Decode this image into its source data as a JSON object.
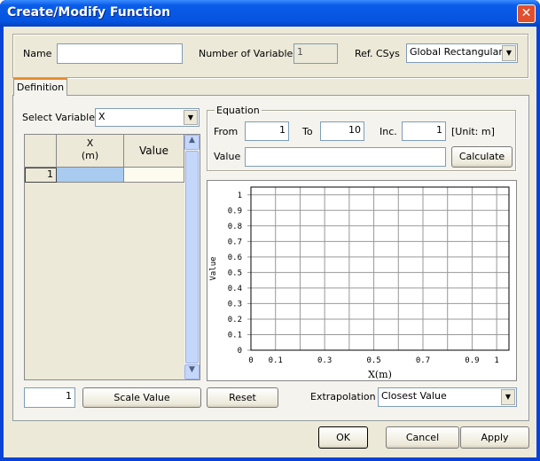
{
  "window": {
    "title": "Create/Modify Function",
    "close_icon": "close-icon"
  },
  "header": {
    "name_label": "Name",
    "name_value": "",
    "num_vars_label": "Number of Variables",
    "num_vars_value": "1",
    "ref_csys_label": "Ref. CSys",
    "ref_csys_value": "Global Rectangular"
  },
  "tabs": [
    {
      "label": "Definition",
      "active": true
    }
  ],
  "definition": {
    "select_variable_label": "Select Variable",
    "select_variable_value": "X",
    "grid": {
      "columns": [
        "",
        "X\n(m)",
        "Value"
      ],
      "col_x_line1": "X",
      "col_x_line2": "(m)",
      "col_value": "Value",
      "rows": [
        {
          "index": "1",
          "x": "",
          "value": ""
        }
      ]
    },
    "equation": {
      "group_label": "Equation",
      "from_label": "From",
      "from_value": "1",
      "to_label": "To",
      "to_value": "10",
      "inc_label": "Inc.",
      "inc_value": "1",
      "unit": "[Unit: m]",
      "value_label": "Value",
      "value_value": "",
      "calculate": "Calculate"
    },
    "scale_value_input": "1",
    "scale_value_button": "Scale Value",
    "reset_button": "Reset",
    "extrapolation_label": "Extrapolation",
    "extrapolation_value": "Closest Value"
  },
  "footer": {
    "ok": "OK",
    "cancel": "Cancel",
    "apply": "Apply"
  },
  "colors": {
    "title_bar": "#0554E0",
    "dialog_bg": "#ECE9D8",
    "selected_cell": "#A9CBF0"
  },
  "chart_data": {
    "type": "line",
    "xlabel": "X(m)",
    "ylabel": "Value",
    "xlim": [
      0,
      1.05
    ],
    "ylim": [
      0,
      1.05
    ],
    "grid": true,
    "x_ticks": [
      "0",
      "0.1",
      "0.2",
      "0.3",
      "0.4",
      "0.5",
      "0.6",
      "0.7",
      "0.8",
      "0.9",
      "1"
    ],
    "x_tick_labels": [
      "0",
      "0.1",
      "",
      "0.3",
      "",
      "0.5",
      "",
      "0.7",
      "",
      "0.9",
      "1"
    ],
    "y_ticks": [
      "0",
      "0.1",
      "0.2",
      "0.3",
      "0.4",
      "0.5",
      "0.6",
      "0.7",
      "0.8",
      "0.9",
      "1"
    ],
    "series": []
  }
}
